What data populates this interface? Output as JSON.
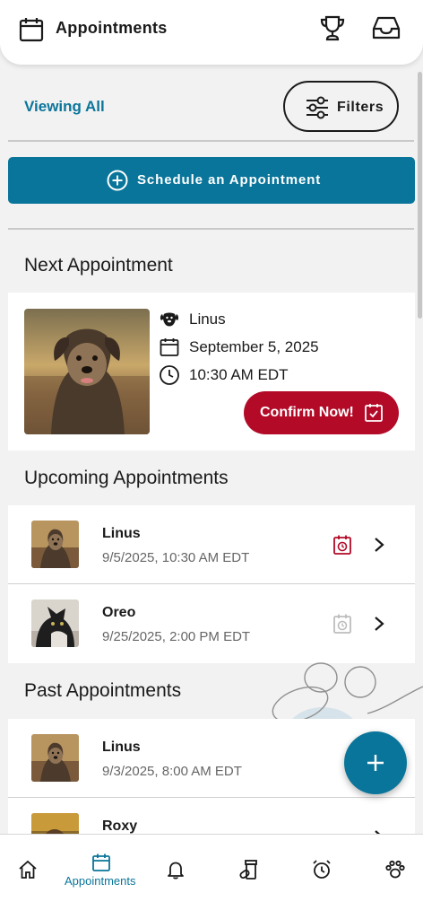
{
  "header": {
    "title": "Appointments"
  },
  "toolbar": {
    "viewing_label": "Viewing All",
    "filters_label": "Filters"
  },
  "schedule_button": {
    "label": "Schedule an Appointment"
  },
  "next_appointment": {
    "section_title": "Next Appointment",
    "pet_name": "Linus",
    "date": "September 5, 2025",
    "time": "10:30 AM EDT",
    "confirm_label": "Confirm Now!"
  },
  "upcoming": {
    "section_title": "Upcoming Appointments",
    "items": [
      {
        "name": "Linus",
        "when": "9/5/2025, 10:30 AM EDT",
        "status_icon": "calendar-clock-icon",
        "status_color": "#b20a27"
      },
      {
        "name": "Oreo",
        "when": "9/25/2025, 2:00 PM EDT",
        "status_icon": "calendar-clock-icon",
        "status_color": "#bdbdbd"
      }
    ]
  },
  "past": {
    "section_title": "Past Appointments",
    "items": [
      {
        "name": "Linus",
        "when": "9/3/2025, 8:00 AM EDT"
      },
      {
        "name": "Roxy",
        "when": ""
      }
    ]
  },
  "bottom_nav": {
    "items": [
      {
        "icon": "home-icon"
      },
      {
        "icon": "calendar-icon",
        "label": "Appointments",
        "active": true
      },
      {
        "icon": "bell-icon"
      },
      {
        "icon": "medication-icon"
      },
      {
        "icon": "alarm-clock-icon"
      },
      {
        "icon": "paw-icon"
      }
    ]
  },
  "colors": {
    "accent": "#0a759a",
    "confirm": "#b20a27",
    "background": "#f2f2f2"
  }
}
